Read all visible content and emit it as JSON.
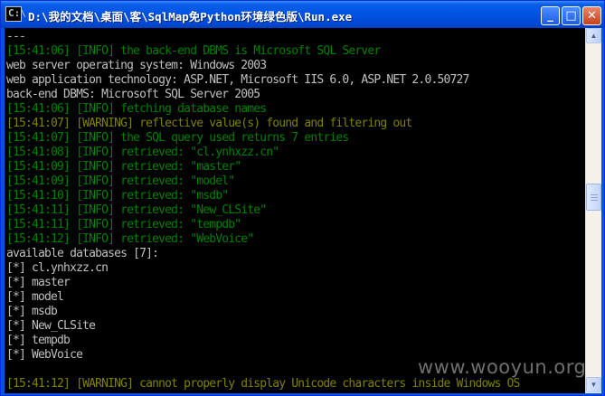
{
  "window": {
    "title": "D:\\我的文档\\桌面\\客\\SqlMap免Python环境绿色版\\Run.exe",
    "icon_label": "C:\\",
    "buttons": {
      "minimize": "_",
      "maximize": "□",
      "close": "✕"
    }
  },
  "console": {
    "lines": [
      {
        "text": "---",
        "color": "#c0c0c0"
      },
      {
        "text": "[15:41:06] [INFO] the back-end DBMS is Microsoft SQL Server",
        "color": "#008000"
      },
      {
        "text": "web server operating system: Windows 2003",
        "color": "#c0c0c0"
      },
      {
        "text": "web application technology: ASP.NET, Microsoft IIS 6.0, ASP.NET 2.0.50727",
        "color": "#c0c0c0"
      },
      {
        "text": "back-end DBMS: Microsoft SQL Server 2005",
        "color": "#c0c0c0"
      },
      {
        "text": "[15:41:06] [INFO] fetching database names",
        "color": "#008000"
      },
      {
        "text": "[15:41:07] [WARNING] reflective value(s) found and filtering out",
        "color": "#808000"
      },
      {
        "text": "[15:41:07] [INFO] the SQL query used returns 7 entries",
        "color": "#008000"
      },
      {
        "text": "[15:41:08] [INFO] retrieved: \"cl.ynhxzz.cn\"",
        "color": "#008000"
      },
      {
        "text": "[15:41:09] [INFO] retrieved: \"master\"",
        "color": "#008000"
      },
      {
        "text": "[15:41:09] [INFO] retrieved: \"model\"",
        "color": "#008000"
      },
      {
        "text": "[15:41:10] [INFO] retrieved: \"msdb\"",
        "color": "#008000"
      },
      {
        "text": "[15:41:11] [INFO] retrieved: \"New_CLSite\"",
        "color": "#008000"
      },
      {
        "text": "[15:41:11] [INFO] retrieved: \"tempdb\"",
        "color": "#008000"
      },
      {
        "text": "[15:41:12] [INFO] retrieved: \"WebVoice\"",
        "color": "#008000"
      },
      {
        "text": "available databases [7]:",
        "color": "#c0c0c0"
      },
      {
        "text": "[*] cl.ynhxzz.cn",
        "color": "#c0c0c0"
      },
      {
        "text": "[*] master",
        "color": "#c0c0c0"
      },
      {
        "text": "[*] model",
        "color": "#c0c0c0"
      },
      {
        "text": "[*] msdb",
        "color": "#c0c0c0"
      },
      {
        "text": "[*] New_CLSite",
        "color": "#c0c0c0"
      },
      {
        "text": "[*] tempdb",
        "color": "#c0c0c0"
      },
      {
        "text": "[*] WebVoice",
        "color": "#c0c0c0"
      },
      {
        "text": "",
        "color": "#c0c0c0"
      },
      {
        "text": "[15:41:12] [WARNING] cannot properly display Unicode characters inside Windows OS",
        "color": "#808000"
      }
    ]
  },
  "scrollbar": {
    "up_arrow": "▲",
    "down_arrow": "▼"
  },
  "watermark": "www.wooyun.org"
}
